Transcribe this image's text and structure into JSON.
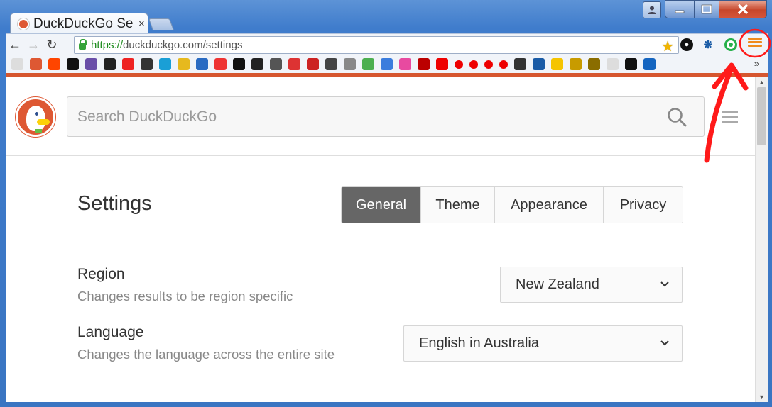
{
  "browser": {
    "tab_title": "DuckDuckGo Se",
    "tab_close": "×",
    "url_scheme": "https://",
    "url_rest": "duckduckgo.com/settings",
    "bookmarks_more": "»",
    "bookmark_icons": [
      "page-icon",
      "duckduckgo-icon",
      "reddit-icon",
      "github-icon",
      "h-icon",
      "s-icon",
      "tomato-icon",
      "circle-icon",
      "tv-icon",
      "imdb-icon",
      "a-icon",
      "target-icon",
      "arrow-icon",
      "tv2-icon",
      "photo-icon",
      "red-icon",
      "epg-icon",
      "tv3-icon",
      "shield-icon",
      "maps-icon",
      "g-icon",
      "tf-icon",
      "tp-icon",
      "w-icon",
      "vodafone-icon",
      "vodafone-icon",
      "vodafone-icon",
      "vodafone-icon",
      "g2-icon",
      "philips-icon",
      "weather-icon",
      "wu-icon",
      "wu2-icon",
      "page2-icon",
      "black-icon",
      "blue-icon"
    ]
  },
  "header": {
    "search_placeholder": "Search DuckDuckGo"
  },
  "settings": {
    "title": "Settings",
    "tabs": [
      {
        "label": "General",
        "active": true
      },
      {
        "label": "Theme",
        "active": false
      },
      {
        "label": "Appearance",
        "active": false
      },
      {
        "label": "Privacy",
        "active": false
      }
    ],
    "region": {
      "label": "Region",
      "description": "Changes results to be region specific",
      "value": "New Zealand"
    },
    "language": {
      "label": "Language",
      "description": "Changes the language across the entire site",
      "value": "English in Australia"
    }
  },
  "colors": {
    "accent": "#de5833",
    "active_tab": "#666666",
    "annotation": "#ff1a1a"
  }
}
